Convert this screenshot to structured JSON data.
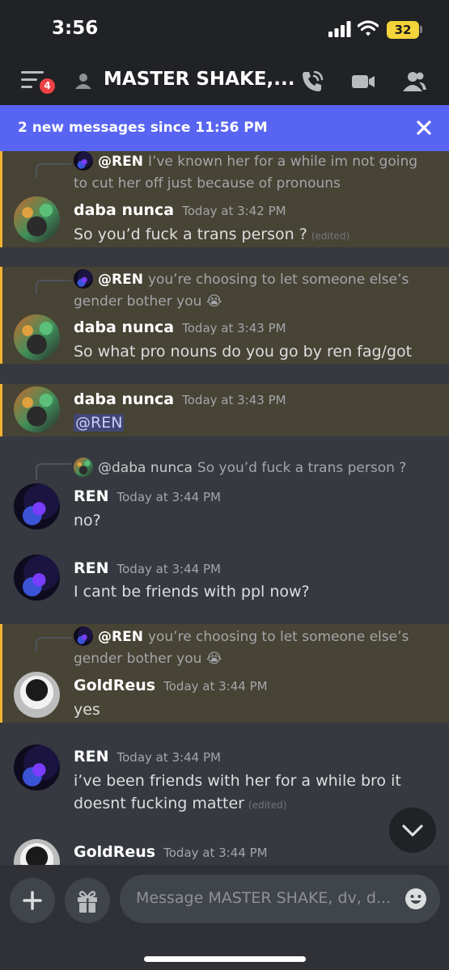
{
  "status_bar": {
    "time": "3:56",
    "battery": "32"
  },
  "header": {
    "unread_badge": "4",
    "title": "MASTER SHAKE,...",
    "icons": [
      "menu-icon",
      "dm-person-icon",
      "voice-call-icon",
      "video-call-icon",
      "members-icon"
    ]
  },
  "banner": {
    "text": "2 new messages since 11:56 PM"
  },
  "messages": [
    {
      "reply": {
        "name": "@REN",
        "text": "I’ve known her for a while im not going to cut her off just because of pronouns"
      },
      "author": "daba nunca",
      "time": "Today at 3:42 PM",
      "text": "So you’d fuck a trans person ?",
      "edited": "(edited)",
      "highlighted": true
    },
    {
      "reply": {
        "name": "@REN",
        "text": "you’re choosing to let someone else’s gender bother you 😭"
      },
      "author": "daba nunca",
      "time": "Today at 3:43 PM",
      "text": "So what pro nouns do you go by ren fag/got",
      "highlighted": true
    },
    {
      "author": "daba nunca",
      "time": "Today at 3:43 PM",
      "mention": "@REN",
      "highlighted": true
    },
    {
      "reply": {
        "name": "@daba nunca",
        "text": "So you’d fuck a trans person ?"
      },
      "author": "REN",
      "time": "Today at 3:44 PM",
      "text": "no?"
    },
    {
      "author": "REN",
      "time": "Today at 3:44 PM",
      "text": "I cant be friends with ppl now?"
    },
    {
      "reply": {
        "name": "@REN",
        "text": "you’re choosing to let someone else’s gender bother you 😭"
      },
      "author": "GoldReus",
      "time": "Today at 3:44 PM",
      "text": "yes",
      "highlighted": true
    },
    {
      "author": "REN",
      "time": "Today at 3:44 PM",
      "text": "i’ve been friends with her for a while bro it doesnt fucking matter",
      "edited": "(edited)"
    },
    {
      "author": "GoldReus",
      "time": "Today at 3:44 PM"
    }
  ],
  "composer": {
    "placeholder": "Message MASTER SHAKE, dv, d...",
    "icons": [
      "plus-icon",
      "gift-icon",
      "emoji-icon"
    ]
  },
  "colors": {
    "background": "#36393f",
    "header": "#202225",
    "banner": "#5865f2",
    "highlight": "#474335",
    "highlight_bar": "#f0b232",
    "badge": "#ed4245"
  }
}
